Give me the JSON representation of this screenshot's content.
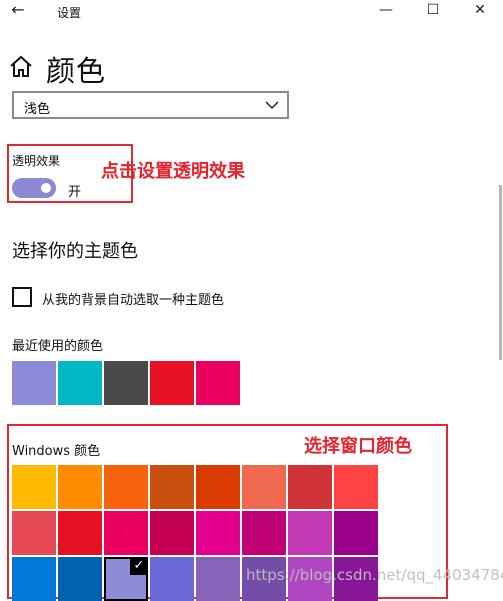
{
  "window": {
    "title": "设置",
    "minimize": "—",
    "maximize": "☐",
    "close": "✕",
    "back": "←"
  },
  "page": {
    "title": "颜色"
  },
  "mode_select": {
    "value": "浅色"
  },
  "transparency": {
    "label": "透明效果",
    "state": "开",
    "on": true,
    "accent": "#8a89d1"
  },
  "annotations": {
    "transparency_note": "点击设置透明效果",
    "windows_note": "选择窗口颜色"
  },
  "accent": {
    "section_title": "选择你的主题色",
    "auto_checkbox_label": "从我的背景自动选取一种主题色",
    "auto_checked": false
  },
  "recent_colors": {
    "label": "最近使用的颜色",
    "colors": [
      "#8e8cd8",
      "#00b7c3",
      "#4c4a48",
      "#e81123",
      "#ea005e"
    ]
  },
  "windows_colors": {
    "label": "Windows 颜色",
    "rows": [
      [
        "#ffb900",
        "#ff8c00",
        "#f7630c",
        "#ca5010",
        "#da3b01",
        "#ef6950",
        "#d13438",
        "#ff4343"
      ],
      [
        "#e74856",
        "#e81123",
        "#ea005e",
        "#c30052",
        "#e3008c",
        "#bf0077",
        "#c239b3",
        "#9a0089"
      ],
      [
        "#0078d7",
        "#0063b1",
        "#8e8cd8",
        "#6b69d6",
        "#8764b8",
        "#744da9",
        "#b146c2",
        "#881798"
      ]
    ],
    "selected": {
      "row": 2,
      "col": 2
    },
    "check_glyph": "✓"
  },
  "watermark": "https://blog.csdn.net/qq_44034784",
  "colors": {
    "annotation_red": "#e4242e",
    "scrollbar": "#b4b4b4"
  },
  "icons": {
    "back": "back-arrow-icon",
    "home": "home-icon",
    "dropdown": "chevron-down-icon",
    "check": "checkmark-icon"
  }
}
